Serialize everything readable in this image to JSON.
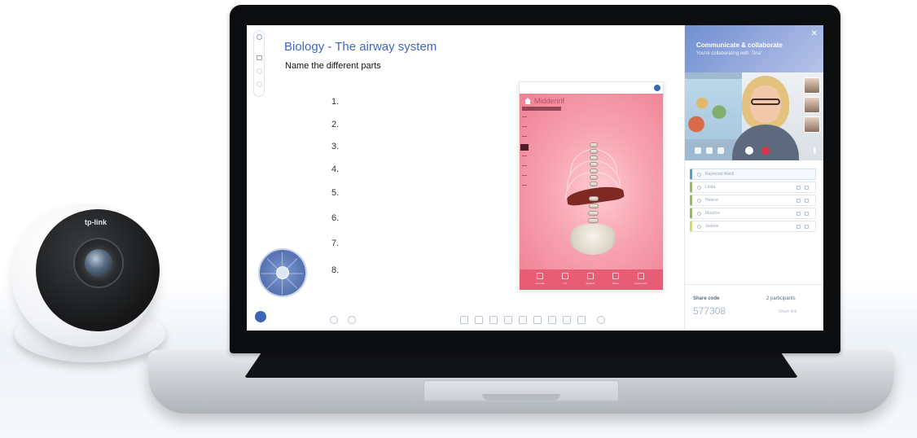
{
  "slide": {
    "title": "Biology - The airway system",
    "subtitle": "Name the different parts",
    "questions": [
      "1.",
      "2.",
      "3.",
      "4.",
      "5.",
      "6.",
      "7.",
      "8."
    ]
  },
  "viewer": {
    "title": "Middenrif",
    "footer_items": [
      "Annotate",
      "Cut",
      "Explode",
      "Share",
      "Augmented"
    ]
  },
  "collaboration": {
    "title": "Communicate & collaborate",
    "subtitle": "You're collaborating with 'Tina'",
    "close_glyph": "✕",
    "participants": [
      "Raymond Weidl",
      "Linda",
      "Helene",
      "Maurice",
      "Jeanne"
    ],
    "share_label": "Share code",
    "share_code": "577308",
    "participant_count": "2 participants",
    "share_link": "Share link"
  },
  "camera": {
    "brand": "tp-link"
  },
  "colors": {
    "accent": "#3f67c4",
    "viewer_pink": "#e85d76",
    "panel_header": "#8ea3dc",
    "end_call": "#d9344a"
  },
  "icons": [
    "settings-icon",
    "square-icon",
    "home-icon",
    "search-icon",
    "close-icon",
    "mic-icon",
    "end-call-icon",
    "undo-icon",
    "redo-icon"
  ]
}
